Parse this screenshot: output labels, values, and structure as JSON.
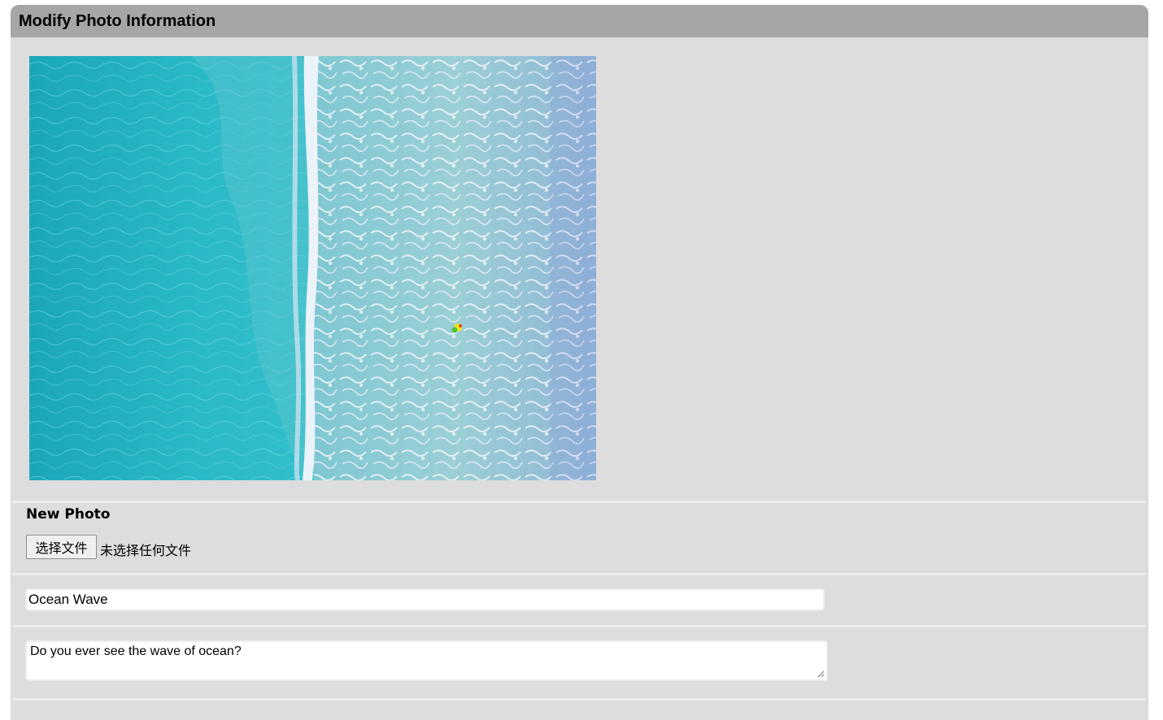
{
  "header": {
    "title": "Modify Photo Information"
  },
  "photo": {
    "alt": "Ocean Wave"
  },
  "new_photo": {
    "label": "New Photo",
    "choose_button": "选择文件",
    "file_status": "未选择任何文件"
  },
  "form": {
    "title_value": "Ocean Wave",
    "description_value": "Do you ever see the wave of ocean?"
  },
  "colors": {
    "header_bg": "#a6a6a6",
    "panel_bg": "#dddddd",
    "ocean_light": "#2bb8c6",
    "surf_white": "#e8eef6"
  }
}
